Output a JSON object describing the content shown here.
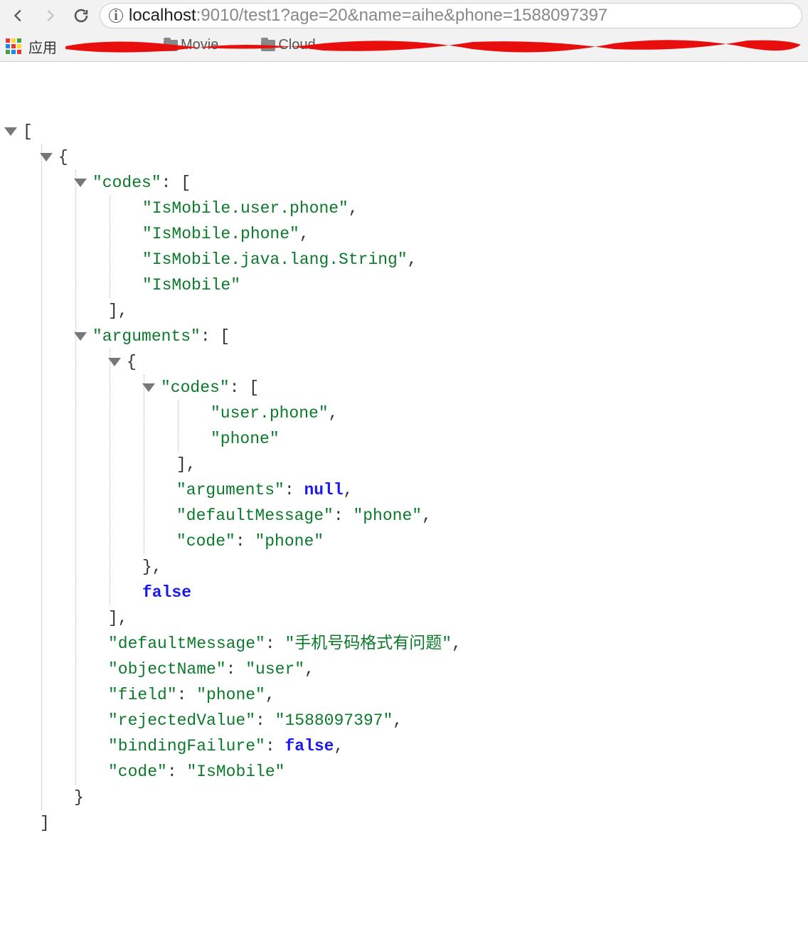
{
  "browser": {
    "url_host": "localhost",
    "url_rest": ":9010/test1?age=20&name=aihe&phone=1588097397",
    "apps_label": "应用",
    "bookmarks": [
      "Movie",
      "Cloud"
    ]
  },
  "json": {
    "root_open": "[",
    "obj_open": "{",
    "codes_key": "\"codes\"",
    "codes_open": ": [",
    "codes_values": [
      "\"IsMobile.user.phone\"",
      "\"IsMobile.phone\"",
      "\"IsMobile.java.lang.String\"",
      "\"IsMobile\""
    ],
    "arr_close": "],",
    "arguments_key": "\"arguments\"",
    "arguments_open": ": [",
    "arg_obj_open": "{",
    "arg_codes_key": "\"codes\"",
    "arg_codes_open": ": [",
    "arg_codes_values": [
      "\"user.phone\"",
      "\"phone\""
    ],
    "arg_arguments_key": "\"arguments\"",
    "arg_arguments_val": "null",
    "arg_defaultMessage_key": "\"defaultMessage\"",
    "arg_defaultMessage_val": "\"phone\"",
    "arg_code_key": "\"code\"",
    "arg_code_val": "\"phone\"",
    "arg_obj_close": "},",
    "false_val": "false",
    "defaultMessage_key": "\"defaultMessage\"",
    "defaultMessage_val": "\"手机号码格式有问题\"",
    "objectName_key": "\"objectName\"",
    "objectName_val": "\"user\"",
    "field_key": "\"field\"",
    "field_val": "\"phone\"",
    "rejectedValue_key": "\"rejectedValue\"",
    "rejectedValue_val": "\"1588097397\"",
    "bindingFailure_key": "\"bindingFailure\"",
    "bindingFailure_val": "false",
    "code_key": "\"code\"",
    "code_val": "\"IsMobile\"",
    "obj_close": "}",
    "root_close": "]",
    "comma": ",",
    "colon": ": "
  }
}
